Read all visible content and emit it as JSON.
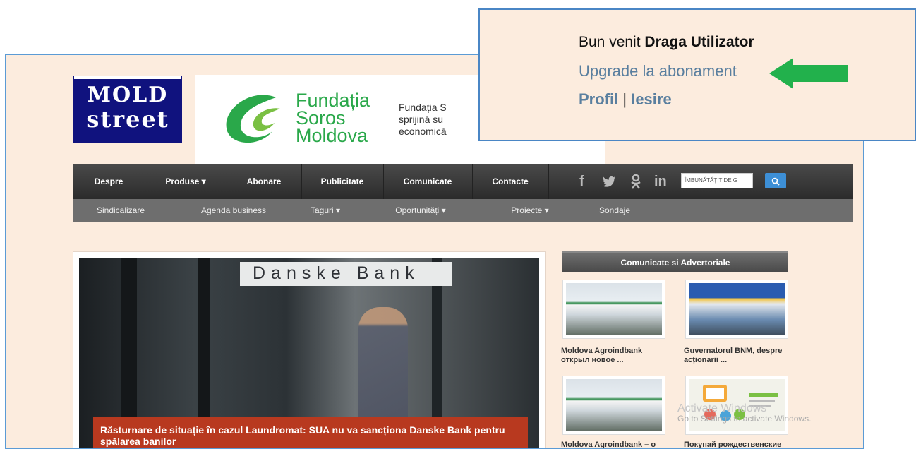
{
  "logo": {
    "line1": "MOLD",
    "line2": "street"
  },
  "sponsor": {
    "name_lines": [
      "Fundația",
      "Soros",
      "Moldova"
    ],
    "description_lines": [
      "Fundația S",
      "sprijină su",
      "economică"
    ]
  },
  "nav": {
    "items": [
      "Despre",
      "Produse ▾",
      "Abonare",
      "Publicitate",
      "Comunicate",
      "Contacte"
    ],
    "social": [
      "f",
      "🐦",
      "ok",
      "in"
    ],
    "search_placeholder": "ÎMBUNĂTĂȚIT DE G",
    "search_icon": "search-icon"
  },
  "subnav": {
    "items": [
      "Sindicalizare",
      "Agenda business",
      "Taguri ▾",
      "Oportunități ▾",
      "Proiecte ▾",
      "Sondaje"
    ]
  },
  "hero": {
    "bank_sign": "Danske Bank",
    "caption": "Răsturnare de situație în cazul Laundromat: SUA nu va sancționa Danske Bank pentru spălarea banilor"
  },
  "sidebar": {
    "header": "Comunicate si Advertoriale",
    "items": [
      {
        "title": "Moldova Agroindbank открыл новое ..."
      },
      {
        "title": "Guvernatorul BNM, despre acționarii ..."
      },
      {
        "title": "Moldova Agroindbank – o"
      },
      {
        "title": "Покупай рождественские"
      }
    ]
  },
  "watermark": {
    "line1": "Activate Windows",
    "line2": "Go to Settings to activate Windows."
  },
  "popup": {
    "welcome_prefix": "Bun venit",
    "welcome_name": "Draga Utilizator",
    "upgrade": "Upgrade la abonament",
    "profile": "Profil",
    "separator": "|",
    "logout": "Iesire"
  },
  "colors": {
    "page_bg": "#fcecde",
    "nav_bg": "#2b2b2b",
    "caption_bg": "#b8391f",
    "soros_green": "#2aa84a",
    "arrow_green": "#22b14c",
    "popup_border": "#4a86c5"
  }
}
